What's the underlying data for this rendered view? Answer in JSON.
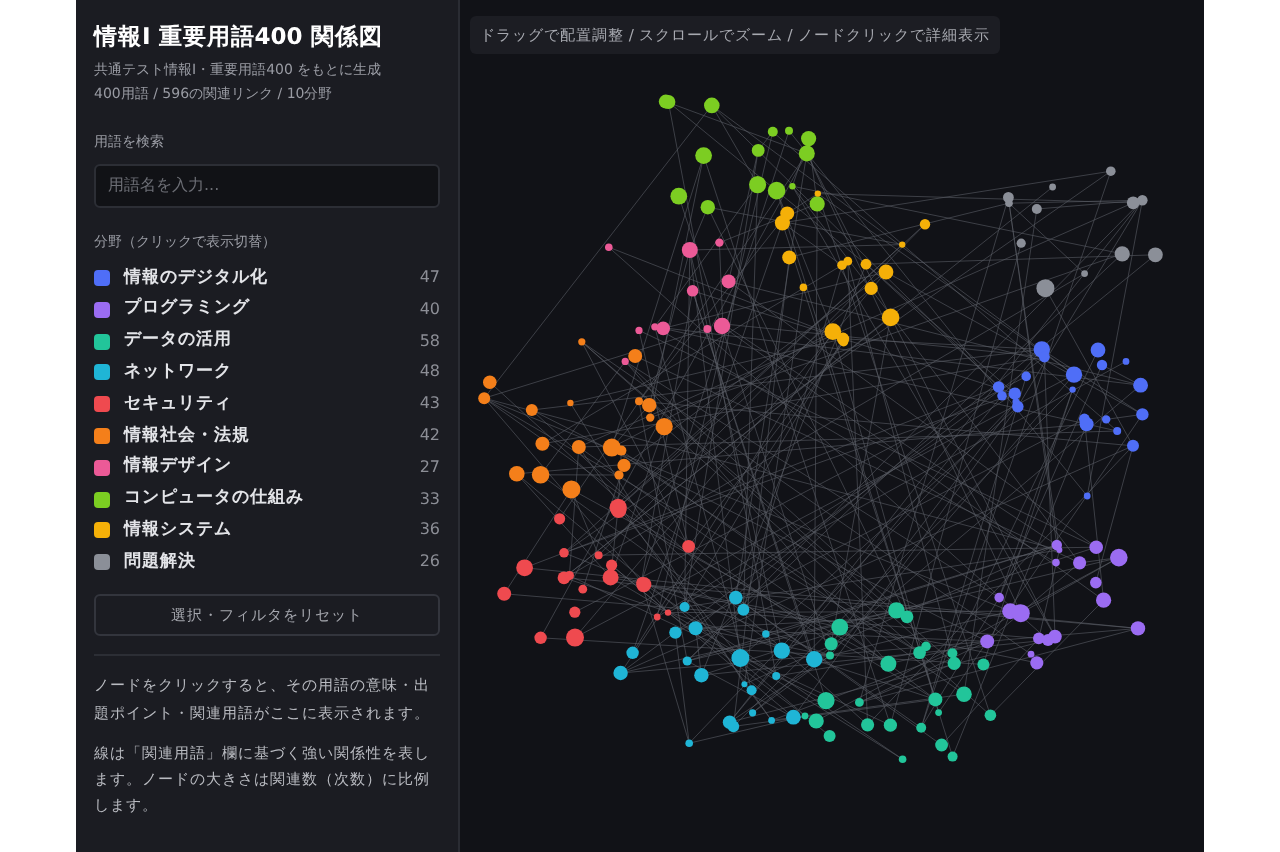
{
  "sidebar": {
    "title": "情報Ⅰ 重要用語400 関係図",
    "subtitle": "共通テスト情報Ⅰ・重要用語400 をもとに生成",
    "stats": "400用語 / 596の関連リンク / 10分野",
    "search": {
      "label": "用語を検索",
      "placeholder": "用語名を入力..."
    },
    "categories_heading": "分野（クリックで表示切替）",
    "categories": [
      {
        "name": "情報のデジタル化",
        "count": "47",
        "color": "#4f6ef7",
        "selected": true
      },
      {
        "name": "プログラミング",
        "count": "40",
        "color": "#9b6cf2",
        "selected": true
      },
      {
        "name": "データの活用",
        "count": "58",
        "color": "#22c59a",
        "selected": true
      },
      {
        "name": "ネットワーク",
        "count": "48",
        "color": "#1fb5d6",
        "selected": true
      },
      {
        "name": "セキュリティ",
        "count": "43",
        "color": "#ef4a4f",
        "selected": true
      },
      {
        "name": "情報社会・法規",
        "count": "42",
        "color": "#f47f1a",
        "selected": true
      },
      {
        "name": "情報デザイン",
        "count": "27",
        "color": "#ec5a97",
        "selected": true
      },
      {
        "name": "コンピュータの仕組み",
        "count": "33",
        "color": "#7ccd22",
        "selected": true
      },
      {
        "name": "情報システム",
        "count": "36",
        "color": "#f5b008",
        "selected": true
      },
      {
        "name": "問題解決",
        "count": "26",
        "color": "#8b8f98",
        "selected": true
      }
    ],
    "reset_button": "選択・フィルタをリセット",
    "paragraphs": [
      "ノードをクリックすると、その用語の意味・出題ポイント・関連用語がここに表示されます。",
      "線は「関連用語」欄に基づく強い関係性を表します。ノードの大きさは関連数（次数）に比例します。"
    ]
  },
  "graph": {
    "hint": "ドラッグで配置調整 / スクロールでズーム / ノードクリックで詳細表示"
  }
}
